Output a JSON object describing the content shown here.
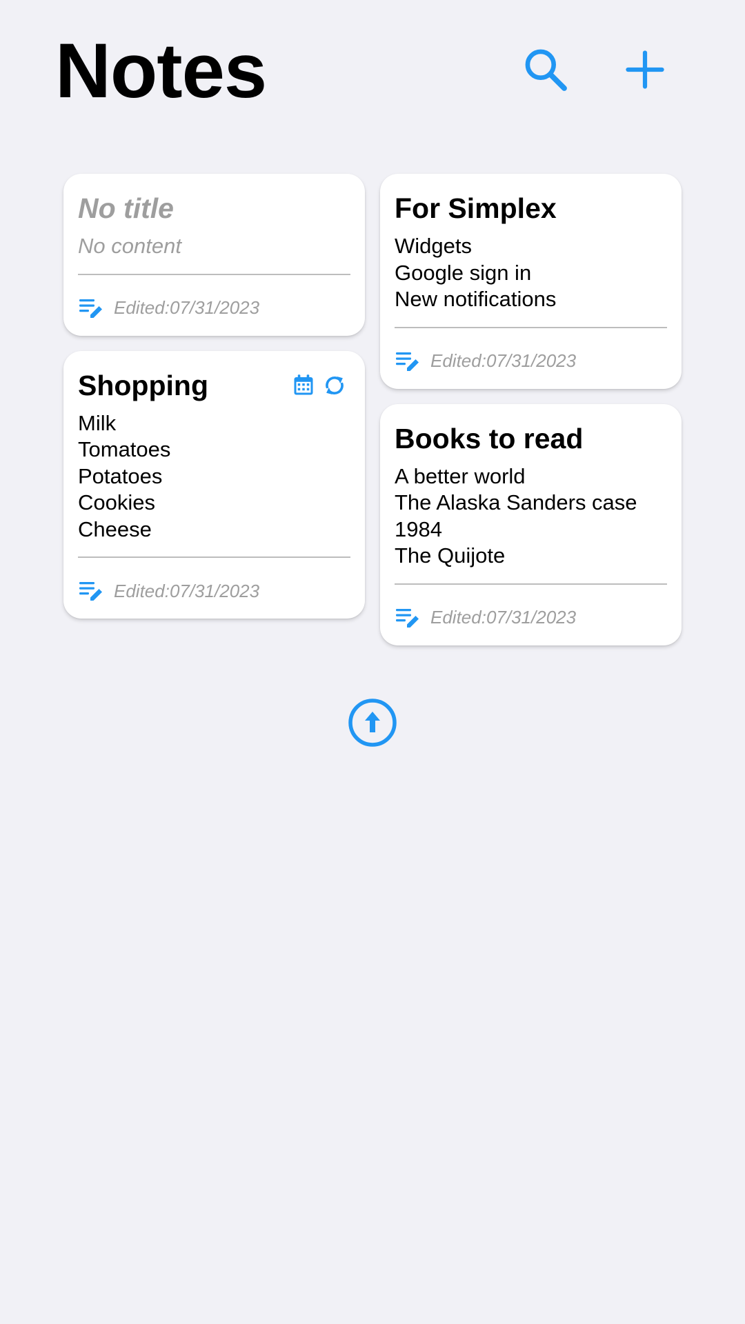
{
  "header": {
    "title": "Notes",
    "search_icon": "search-icon",
    "add_icon": "plus-icon"
  },
  "colors": {
    "accent": "#2196F3",
    "background": "#F1F1F6",
    "card": "#FFFFFF",
    "muted_text": "#9E9E9E",
    "divider": "#BDBDBD"
  },
  "notes": {
    "no_title": {
      "title": "No title",
      "content": "No content",
      "edited": "Edited:07/31/2023",
      "edit_icon": "edit-note-icon"
    },
    "shopping": {
      "title": "Shopping",
      "lines": [
        "Milk",
        "Tomatoes",
        "Potatoes",
        "Cookies",
        "Cheese"
      ],
      "edited": "Edited:07/31/2023",
      "badges": [
        "calendar-icon",
        "sync-icon"
      ],
      "edit_icon": "edit-note-icon"
    },
    "for_simplex": {
      "title": "For Simplex",
      "lines": [
        "Widgets",
        "Google sign in",
        "New notifications"
      ],
      "edited": "Edited:07/31/2023",
      "edit_icon": "edit-note-icon"
    },
    "books": {
      "title": "Books to read",
      "lines": [
        "A better world",
        "The Alaska Sanders case",
        "1984",
        "The Quijote"
      ],
      "edited": "Edited:07/31/2023",
      "edit_icon": "edit-note-icon"
    }
  },
  "scroll_top_icon": "arrow-up-circle-icon"
}
